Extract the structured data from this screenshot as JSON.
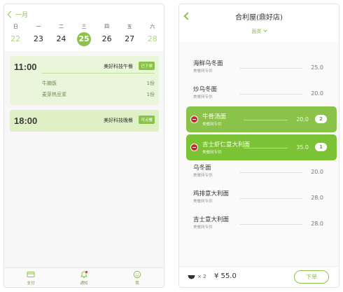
{
  "left": {
    "back_label": "一月",
    "week": [
      {
        "weekday": "日",
        "date": "22",
        "state": "muted"
      },
      {
        "weekday": "一",
        "date": "23",
        "state": "normal"
      },
      {
        "weekday": "二",
        "date": "24",
        "state": "normal"
      },
      {
        "weekday": "三",
        "date": "25",
        "state": "selected"
      },
      {
        "weekday": "四",
        "date": "26",
        "state": "normal"
      },
      {
        "weekday": "五",
        "date": "27",
        "state": "normal"
      },
      {
        "weekday": "六",
        "date": "28",
        "state": "muted"
      }
    ],
    "meals": [
      {
        "time": "11:00",
        "name": "美好科技午餐",
        "tag": "已下单",
        "items": [
          {
            "name": "牛腩饭",
            "qty": "1份"
          },
          {
            "name": "麦芽热豆浆",
            "qty": "1份"
          }
        ]
      },
      {
        "time": "18:00",
        "name": "美好科技晚餐",
        "tag": "可点餐",
        "items": []
      }
    ],
    "tabs": [
      {
        "label": "支付",
        "icon": "card-icon"
      },
      {
        "label": "通知",
        "icon": "bell-icon"
      },
      {
        "label": "我",
        "icon": "smiley-icon"
      }
    ]
  },
  "right": {
    "title": "合利屋(鼎好店)",
    "category": "面类",
    "dishes": [
      {
        "name": "海鲜乌冬面",
        "sub": "美餐网专供",
        "price": "25.0",
        "selected": false
      },
      {
        "name": "炒乌冬面",
        "sub": "美餐网专供",
        "price": "20.0",
        "selected": false
      },
      {
        "name": "牛骨汤面",
        "sub": "美餐网专供",
        "price": "20.0",
        "selected": true,
        "qty": "2"
      },
      {
        "name": "吉士虾仁意大利面",
        "sub": "美餐网专供",
        "price": "35.0",
        "selected": true,
        "qty": "1"
      },
      {
        "name": "乌冬面",
        "sub": "美餐网专供",
        "price": "20.0",
        "selected": false
      },
      {
        "name": "鸡排意大利面",
        "sub": "美餐网专供",
        "price": "28.0",
        "selected": false
      },
      {
        "name": "吉士意大利面",
        "sub": "美餐网专供",
        "price": "28.0",
        "selected": false
      }
    ],
    "footer": {
      "count": "× 2",
      "total": "¥ 55.0",
      "order_label": "下单"
    }
  },
  "colors": {
    "accent": "#8bc34a",
    "card_bg": "#e9f6d9",
    "badge_red": "#c62828"
  }
}
